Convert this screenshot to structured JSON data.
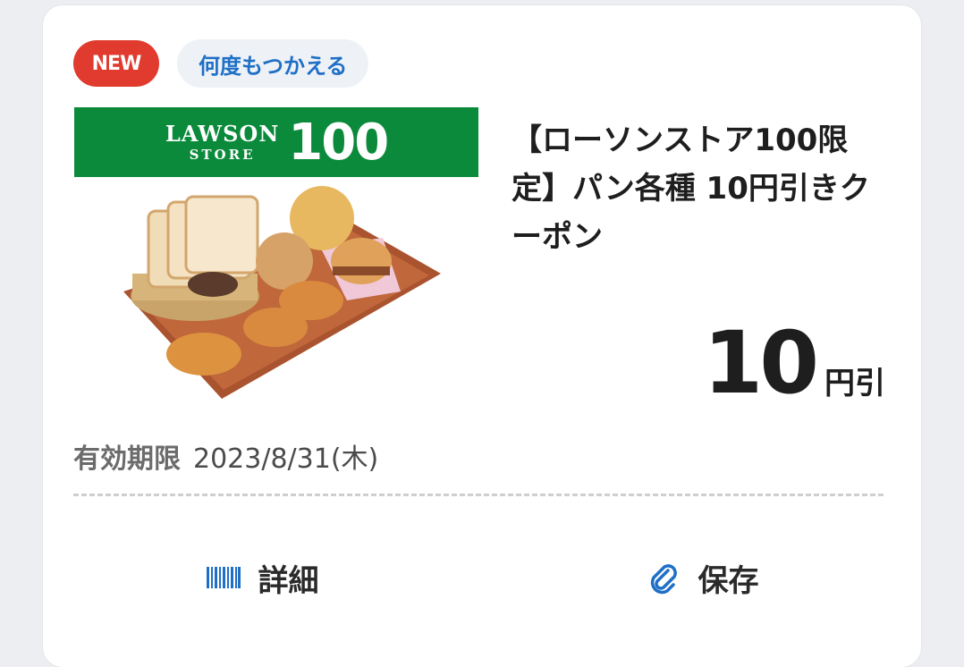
{
  "badges": {
    "new": "NEW",
    "reusable": "何度もつかえる"
  },
  "banner": {
    "line1": "LAWSON",
    "line2": "STORE",
    "number": "100"
  },
  "coupon": {
    "title": "【ローソンストア100限定】パン各種 10円引きクーポン",
    "discount_value": "10",
    "discount_unit": "円引"
  },
  "expiry": {
    "label": "有効期限",
    "date": "2023/8/31(木)"
  },
  "actions": {
    "details_label": "詳細",
    "details_icon": "barcode-icon",
    "save_label": "保存",
    "save_icon": "paperclip-icon"
  },
  "colors": {
    "new_badge": "#e03b2e",
    "reusable_text": "#1f6fc6",
    "banner_green": "#0a8a3a",
    "icon_blue": "#1f6fc6"
  }
}
